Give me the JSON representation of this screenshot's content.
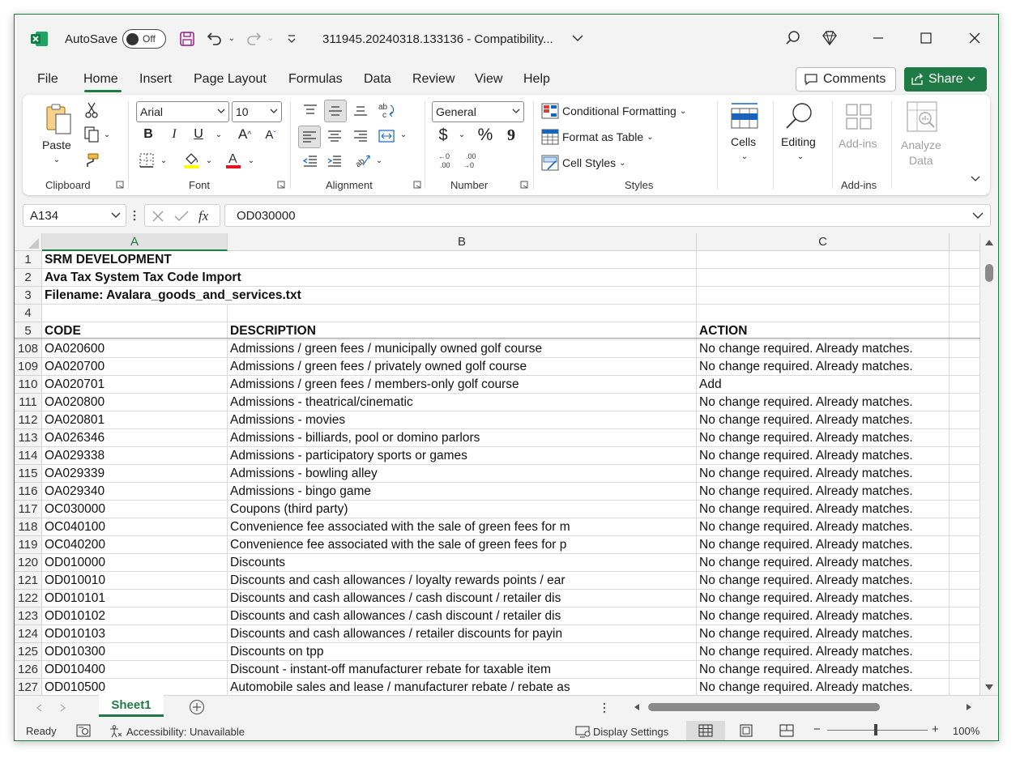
{
  "app": {
    "autosave_label": "AutoSave",
    "autosave_state": "Off",
    "doc_title": "311945.20240318.133136  -  Compatibility...",
    "brand_color": "#1f7a45"
  },
  "menu": {
    "tabs": [
      "File",
      "Home",
      "Insert",
      "Page Layout",
      "Formulas",
      "Data",
      "Review",
      "View",
      "Help"
    ],
    "active_tab": "Home",
    "comments_label": "Comments",
    "share_label": "Share"
  },
  "ribbon": {
    "clipboard": {
      "paste_label": "Paste",
      "group_label": "Clipboard"
    },
    "font": {
      "family": "Arial",
      "size": "10",
      "group_label": "Font",
      "bold": "B",
      "italic": "I",
      "underline": "U",
      "grow": "A",
      "shrink": "A",
      "fill_color": "#ffff00",
      "font_color": "#e81123"
    },
    "alignment": {
      "group_label": "Alignment"
    },
    "number": {
      "format": "General",
      "currency": "$",
      "percent": "%",
      "comma": "9",
      "inc_dec": ".00",
      "group_label": "Number"
    },
    "styles": {
      "conditional_formatting": "Conditional Formatting",
      "format_as_table": "Format as Table",
      "cell_styles": "Cell Styles",
      "group_label": "Styles"
    },
    "cells": {
      "label": "Cells"
    },
    "editing": {
      "label": "Editing"
    },
    "addins": {
      "label": "Add-ins",
      "group_label": "Add-ins"
    },
    "analyze": {
      "label_line1": "Analyze",
      "label_line2": "Data"
    }
  },
  "formula_bar": {
    "name_box": "A134",
    "fx": "fx",
    "value": "OD030000"
  },
  "grid": {
    "columns": [
      "A",
      "B",
      "C"
    ],
    "selected_column": "A",
    "rows": [
      {
        "num": "1",
        "a": "SRM DEVELOPMENT",
        "b": "",
        "c": "",
        "bold": true
      },
      {
        "num": "2",
        "a": "Ava Tax System Tax Code Import",
        "b": "",
        "c": "",
        "bold": true
      },
      {
        "num": "3",
        "a": "Filename: Avalara_goods_and_services.txt",
        "b": "",
        "c": "",
        "bold": true
      },
      {
        "num": "4",
        "a": "",
        "b": "",
        "c": "",
        "bold": false
      },
      {
        "num": "5",
        "a": "CODE",
        "b": "DESCRIPTION",
        "c": "ACTION",
        "bold": true
      },
      {
        "num": "108",
        "a": "OA020600",
        "b": "Admissions / green fees / municipally owned golf course",
        "c": "No change required. Already matches.",
        "bold": false
      },
      {
        "num": "109",
        "a": "OA020700",
        "b": "Admissions / green fees / privately owned golf course",
        "c": "No change required. Already matches.",
        "bold": false
      },
      {
        "num": "110",
        "a": "OA020701",
        "b": "Admissions / green fees / members-only golf course",
        "c": "Add",
        "bold": false
      },
      {
        "num": "111",
        "a": "OA020800",
        "b": "Admissions - theatrical/cinematic",
        "c": "No change required. Already matches.",
        "bold": false
      },
      {
        "num": "112",
        "a": "OA020801",
        "b": "Admissions - movies",
        "c": "No change required. Already matches.",
        "bold": false
      },
      {
        "num": "113",
        "a": "OA026346",
        "b": "Admissions - billiards, pool or domino parlors",
        "c": "No change required. Already matches.",
        "bold": false
      },
      {
        "num": "114",
        "a": "OA029338",
        "b": "Admissions - participatory sports or games",
        "c": "No change required. Already matches.",
        "bold": false
      },
      {
        "num": "115",
        "a": "OA029339",
        "b": "Admissions - bowling alley",
        "c": "No change required. Already matches.",
        "bold": false
      },
      {
        "num": "116",
        "a": "OA029340",
        "b": "Admissions - bingo game",
        "c": "No change required. Already matches.",
        "bold": false
      },
      {
        "num": "117",
        "a": "OC030000",
        "b": "Coupons (third party)",
        "c": "No change required. Already matches.",
        "bold": false
      },
      {
        "num": "118",
        "a": "OC040100",
        "b": "Convenience fee associated with the sale of green fees for m",
        "c": "No change required. Already matches.",
        "bold": false
      },
      {
        "num": "119",
        "a": "OC040200",
        "b": "Convenience fee associated with the sale of green fees for p",
        "c": "No change required. Already matches.",
        "bold": false
      },
      {
        "num": "120",
        "a": "OD010000",
        "b": "Discounts",
        "c": "No change required. Already matches.",
        "bold": false
      },
      {
        "num": "121",
        "a": "OD010010",
        "b": "Discounts and cash allowances / loyalty rewards points / ear",
        "c": "No change required. Already matches.",
        "bold": false
      },
      {
        "num": "122",
        "a": "OD010101",
        "b": "Discounts and cash allowances / cash discount / retailer dis",
        "c": "No change required. Already matches.",
        "bold": false
      },
      {
        "num": "123",
        "a": "OD010102",
        "b": "Discounts and cash allowances / cash discount / retailer dis",
        "c": "No change required. Already matches.",
        "bold": false
      },
      {
        "num": "124",
        "a": "OD010103",
        "b": "Discounts and cash allowances / retailer discounts for payin",
        "c": "No change required. Already matches.",
        "bold": false
      },
      {
        "num": "125",
        "a": "OD010300",
        "b": "Discounts on tpp",
        "c": "No change required. Already matches.",
        "bold": false
      },
      {
        "num": "126",
        "a": "OD010400",
        "b": "Discount - instant-off manufacturer rebate for taxable item",
        "c": "No change required. Already matches.",
        "bold": false
      },
      {
        "num": "127",
        "a": "OD010500",
        "b": "Automobile sales and lease / manufacturer rebate / rebate as",
        "c": "No change required. Already matches.",
        "bold": false
      }
    ]
  },
  "sheets": {
    "active": "Sheet1"
  },
  "status": {
    "ready": "Ready",
    "accessibility": "Accessibility: Unavailable",
    "display_settings": "Display Settings",
    "zoom_minus": "−",
    "zoom_plus": "+",
    "zoom": "100%",
    "zoom_level": 100
  }
}
